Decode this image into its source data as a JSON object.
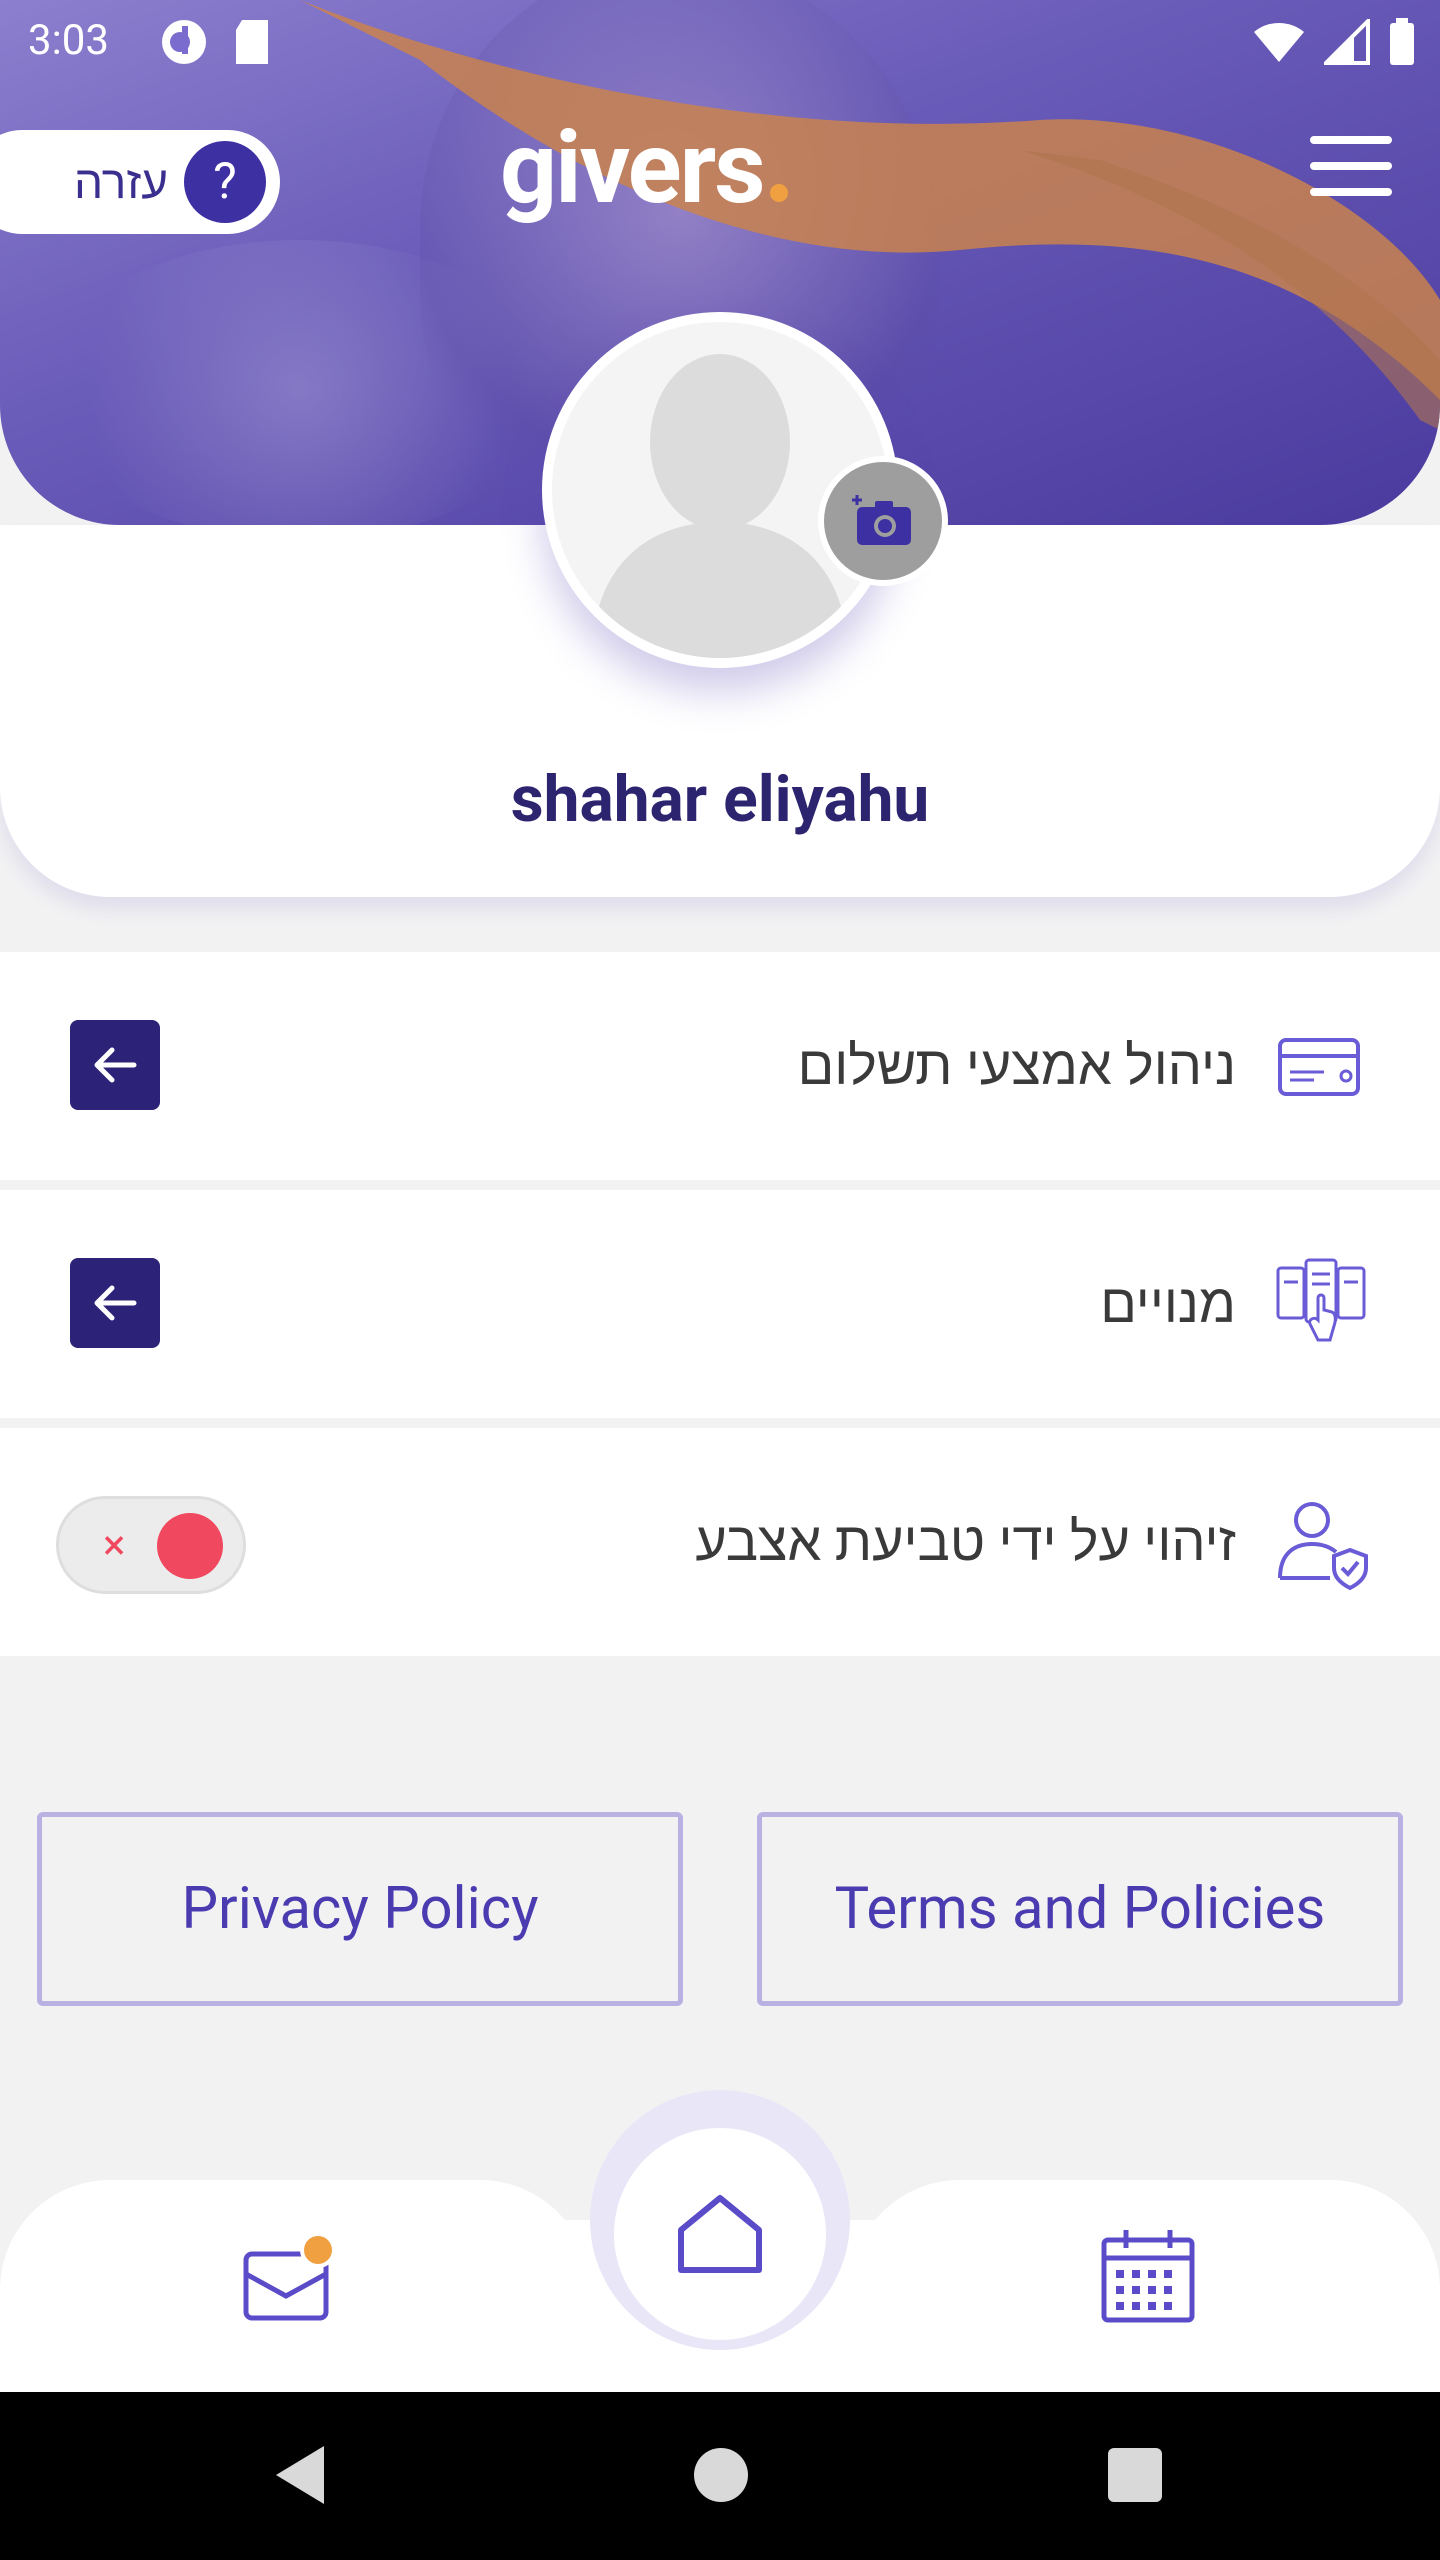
{
  "status_bar": {
    "time": "3:03"
  },
  "header": {
    "logo_text": "givers",
    "help_label": "עזרה",
    "help_icon_text": "?"
  },
  "profile": {
    "name": "shahar eliyahu"
  },
  "menu": [
    {
      "label": "ניהול אמצעי תשלום",
      "icon": "credit-card-icon",
      "action": "arrow-left"
    },
    {
      "label": "מנויים",
      "icon": "subscriptions-icon",
      "action": "arrow-left"
    },
    {
      "label": "זיהוי על ידי טביעת אצבע",
      "icon": "user-shield-icon",
      "action": "toggle",
      "toggle_on": false,
      "toggle_x": "×"
    }
  ],
  "policies": {
    "privacy_label": "Privacy Policy",
    "terms_label": "Terms and Policies"
  },
  "bottom_nav": [
    "mail-icon",
    "home-icon",
    "calendar-icon"
  ],
  "colors": {
    "primary": "#3d30a2",
    "dark_primary": "#2c2277",
    "accent_orange": "#f0a040",
    "toggle_red": "#f0495f"
  }
}
